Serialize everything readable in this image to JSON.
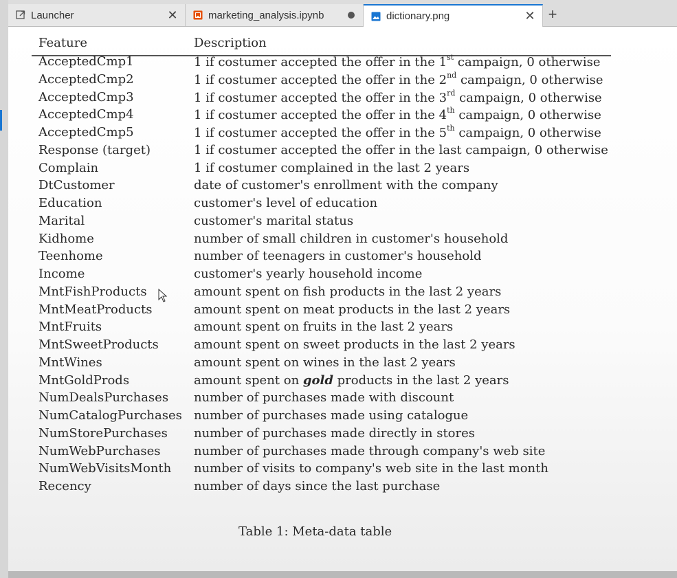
{
  "tabs": [
    {
      "label": "Launcher",
      "icon": "launcher-icon"
    },
    {
      "label": "marketing_analysis.ipynb",
      "icon": "notebook-icon"
    },
    {
      "label": "dictionary.png",
      "icon": "image-icon"
    }
  ],
  "accent_color": "#1976d2",
  "table": {
    "header_feature": "Feature",
    "header_description": "Description",
    "rows": [
      {
        "feature": "AcceptedCmp1",
        "pre": "1 if costumer accepted the offer in the 1",
        "sup": "st",
        "post": " campaign, 0 otherwise"
      },
      {
        "feature": "AcceptedCmp2",
        "pre": "1 if costumer accepted the offer in the 2",
        "sup": "nd",
        "post": " campaign, 0 otherwise"
      },
      {
        "feature": "AcceptedCmp3",
        "pre": "1 if costumer accepted the offer in the 3",
        "sup": "rd",
        "post": " campaign, 0 otherwise"
      },
      {
        "feature": "AcceptedCmp4",
        "pre": "1 if costumer accepted the offer in the 4",
        "sup": "th",
        "post": " campaign, 0 otherwise"
      },
      {
        "feature": "AcceptedCmp5",
        "pre": "1 if costumer accepted the offer in the 5",
        "sup": "th",
        "post": " campaign, 0 otherwise"
      },
      {
        "feature": "Response (target)",
        "pre": "1 if costumer accepted the offer in the last campaign, 0 otherwise",
        "sup": "",
        "post": ""
      },
      {
        "feature": "Complain",
        "pre": "1 if costumer complained in the last 2 years",
        "sup": "",
        "post": ""
      },
      {
        "feature": "DtCustomer",
        "pre": "date of customer's enrollment with the company",
        "sup": "",
        "post": ""
      },
      {
        "feature": "Education",
        "pre": "customer's level of education",
        "sup": "",
        "post": ""
      },
      {
        "feature": "Marital",
        "pre": "customer's marital status",
        "sup": "",
        "post": ""
      },
      {
        "feature": "Kidhome",
        "pre": "number of small children in customer's household",
        "sup": "",
        "post": ""
      },
      {
        "feature": "Teenhome",
        "pre": "number of teenagers in customer's household",
        "sup": "",
        "post": ""
      },
      {
        "feature": "Income",
        "pre": "customer's yearly household income",
        "sup": "",
        "post": ""
      },
      {
        "feature": "MntFishProducts",
        "pre": "amount spent on fish products in the last 2 years",
        "sup": "",
        "post": ""
      },
      {
        "feature": "MntMeatProducts",
        "pre": "amount spent on meat products in the last 2 years",
        "sup": "",
        "post": ""
      },
      {
        "feature": "MntFruits",
        "pre": "amount spent on fruits in the last 2 years",
        "sup": "",
        "post": ""
      },
      {
        "feature": "MntSweetProducts",
        "pre": "amount spent on sweet products in the last 2 years",
        "sup": "",
        "post": ""
      },
      {
        "feature": "MntWines",
        "pre": "amount spent on wines in the last 2 years",
        "sup": "",
        "post": ""
      },
      {
        "feature": "MntGoldProds",
        "pre": "amount spent on ",
        "em": "gold",
        "post": " products in the last 2 years"
      },
      {
        "feature": "NumDealsPurchases",
        "pre": "number of purchases made with discount",
        "sup": "",
        "post": ""
      },
      {
        "feature": "NumCatalogPurchases",
        "pre": "number of purchases made using catalogue",
        "sup": "",
        "post": ""
      },
      {
        "feature": "NumStorePurchases",
        "pre": "number of purchases made directly in stores",
        "sup": "",
        "post": ""
      },
      {
        "feature": "NumWebPurchases",
        "pre": "number of purchases made through company's web site",
        "sup": "",
        "post": ""
      },
      {
        "feature": "NumWebVisitsMonth",
        "pre": "number of visits to company's web site in the last month",
        "sup": "",
        "post": ""
      },
      {
        "feature": "Recency",
        "pre": "number of days since the last purchase",
        "sup": "",
        "post": ""
      }
    ],
    "caption": "Table 1: Meta-data table"
  }
}
